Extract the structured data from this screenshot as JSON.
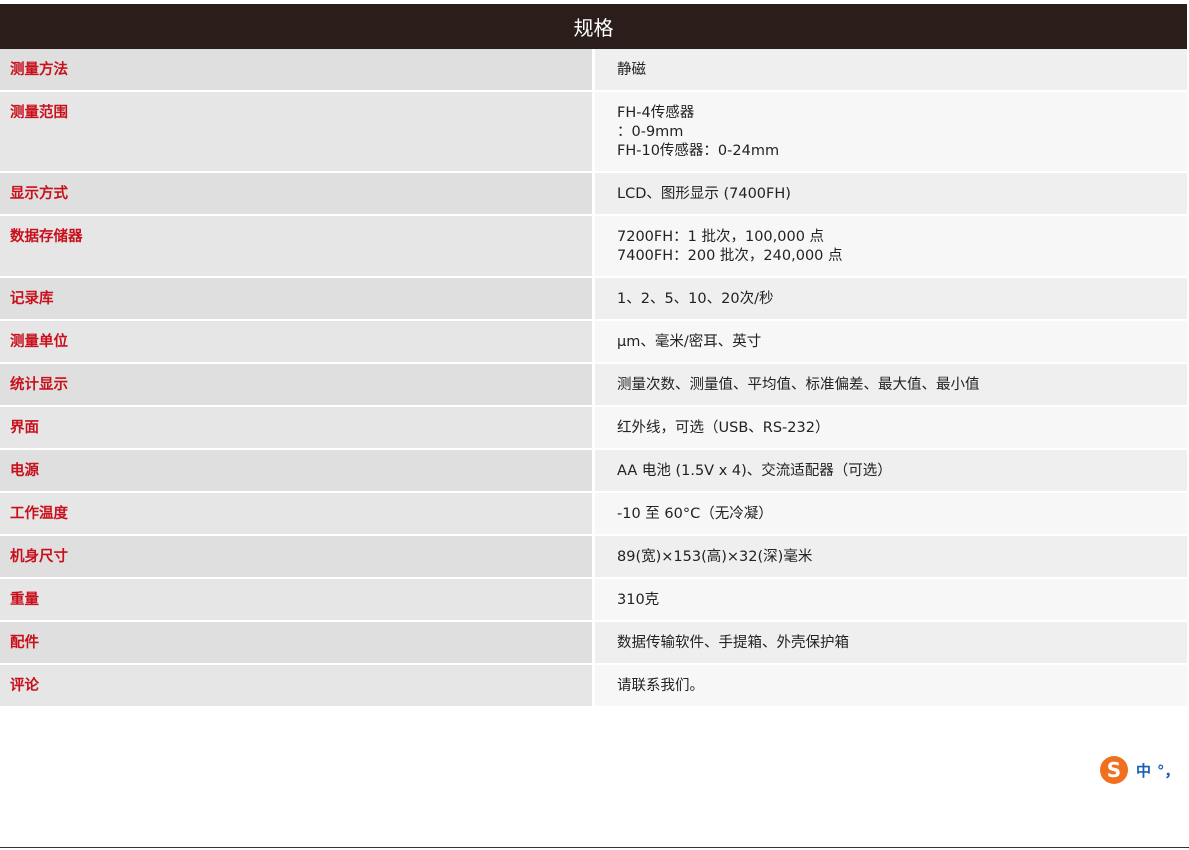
{
  "spec": {
    "title": "规格",
    "rows": [
      {
        "label": "测量方法",
        "lines": [
          "静磁"
        ]
      },
      {
        "label": "测量范围",
        "lines": [
          "FH-4传感器",
          "：0-9mm",
          "FH-10传感器：0-24mm"
        ]
      },
      {
        "label": "显示方式",
        "lines": [
          "LCD、图形显示 (7400FH)"
        ]
      },
      {
        "label": "数据存储器",
        "lines": [
          "7200FH：1 批次，100,000 点",
          "7400FH：200 批次，240,000 点"
        ]
      },
      {
        "label": "记录库",
        "lines": [
          "1、2、5、10、20次/秒"
        ]
      },
      {
        "label": "测量单位",
        "lines": [
          "μm、毫米/密耳、英寸"
        ]
      },
      {
        "label": "统计显示",
        "lines": [
          "测量次数、测量值、平均值、标准偏差、最大值、最小值"
        ]
      },
      {
        "label": "界面",
        "lines": [
          "红外线，可选（USB、RS-232）"
        ]
      },
      {
        "label": "电源",
        "lines": [
          "AA 电池 (1.5V x 4)、交流适配器（可选）"
        ]
      },
      {
        "label": "工作温度",
        "lines": [
          "-10 至 60°C（无冷凝）"
        ]
      },
      {
        "label": "机身尺寸",
        "lines": [
          "89(宽)×153(高)×32(深)毫米"
        ]
      },
      {
        "label": "重量",
        "lines": [
          "310克"
        ]
      },
      {
        "label": "配件",
        "lines": [
          "数据传输软件、手提箱、外壳保护箱"
        ]
      },
      {
        "label": "评论",
        "lines": [
          "请联系我们。"
        ]
      }
    ]
  },
  "ime_toolbar": {
    "logo_icon": "sogou-s-icon",
    "mode": "中",
    "punct": "°，"
  },
  "colors": {
    "header_bg": "#2a1d1a",
    "label_text": "#c8101c",
    "ime_accent": "#f07020"
  }
}
